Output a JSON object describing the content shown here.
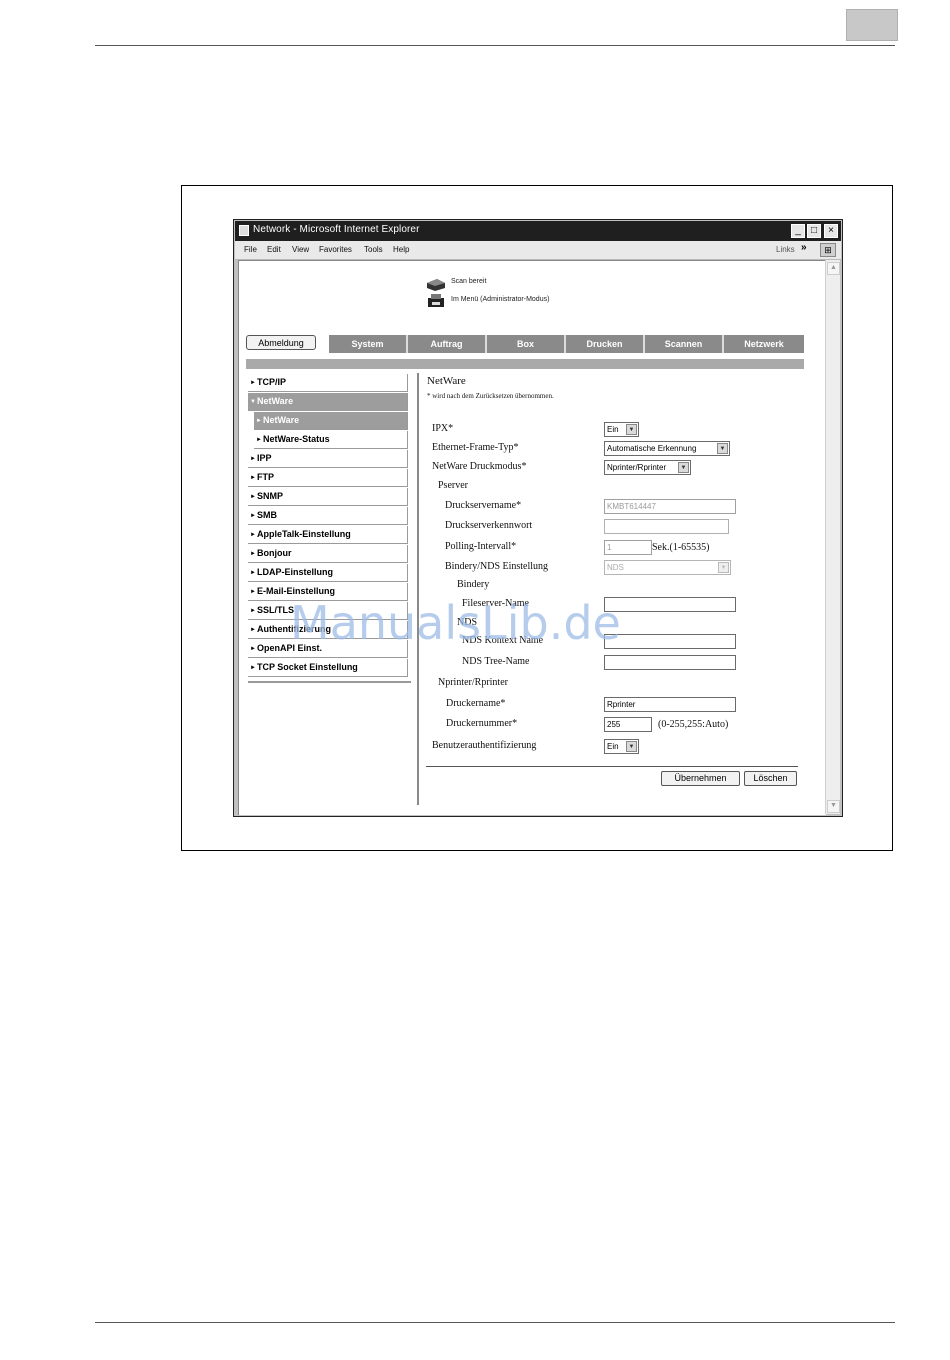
{
  "window": {
    "title": "Network - Microsoft Internet Explorer",
    "controls": [
      "_",
      "□",
      "×"
    ]
  },
  "menubar": {
    "items": [
      "File",
      "Edit",
      "View",
      "Favorites",
      "Tools",
      "Help"
    ],
    "links_label": "Links",
    "links_chevron": "»"
  },
  "status": {
    "line1": "Scan bereit",
    "line2": "Im Menü (Administrator-Modus)"
  },
  "nav": {
    "logout": "Abmeldung",
    "tabs": [
      "System",
      "Auftrag",
      "Box",
      "Drucken",
      "Scannen",
      "Netzwerk"
    ]
  },
  "sidebar": {
    "items": [
      {
        "label": "TCP/IP",
        "arrow": "►"
      },
      {
        "label": "NetWare",
        "arrow": "▼"
      },
      {
        "label": "NetWare",
        "arrow": "►"
      },
      {
        "label": "NetWare-Status",
        "arrow": "►"
      },
      {
        "label": "IPP",
        "arrow": "►"
      },
      {
        "label": "FTP",
        "arrow": "►"
      },
      {
        "label": "SNMP",
        "arrow": "►"
      },
      {
        "label": "SMB",
        "arrow": "►"
      },
      {
        "label": "AppleTalk-Einstellung",
        "arrow": "►"
      },
      {
        "label": "Bonjour",
        "arrow": "►"
      },
      {
        "label": "LDAP-Einstellung",
        "arrow": "►"
      },
      {
        "label": "E-Mail-Einstellung",
        "arrow": "►"
      },
      {
        "label": "SSL/TLS",
        "arrow": "►"
      },
      {
        "label": "Authentifizierung",
        "arrow": "►"
      },
      {
        "label": "OpenAPI Einst.",
        "arrow": "►"
      },
      {
        "label": "TCP Socket Einstellung",
        "arrow": "►"
      }
    ]
  },
  "form": {
    "heading": "NetWare",
    "note": "* wird nach dem Zurücksetzen übernommen.",
    "ipx": {
      "label": "IPX*",
      "value": "Ein"
    },
    "frame_type": {
      "label": "Ethernet-Frame-Typ*",
      "value": "Automatische Erkennung"
    },
    "print_mode": {
      "label": "NetWare Druckmodus*",
      "value": "Nprinter/Rprinter"
    },
    "pserver_section": "Pserver",
    "print_server_name": {
      "label": "Druckservername*",
      "value": "KMBT614447"
    },
    "print_server_password": {
      "label": "Druckserverkennwort",
      "value": ""
    },
    "polling": {
      "label": "Polling-Intervall*",
      "value": "1",
      "unit": "Sek.(1-65535)"
    },
    "bindery_nds": {
      "label": "Bindery/NDS Einstellung",
      "value": "NDS"
    },
    "bindery_section": "Bindery",
    "fileserver_name": {
      "label": "Fileserver-Name",
      "value": ""
    },
    "nds_section": "NDS",
    "nds_context": {
      "label": "NDS Kontext Name",
      "value": ""
    },
    "nds_tree": {
      "label": "NDS Tree-Name",
      "value": ""
    },
    "nprinter_section": "Nprinter/Rprinter",
    "printer_name": {
      "label": "Druckername*",
      "value": "Rprinter"
    },
    "printer_number": {
      "label": "Druckernummer*",
      "value": "255",
      "range": "(0-255,255:Auto)"
    },
    "user_auth": {
      "label": "Benutzerauthentifizierung",
      "value": "Ein"
    },
    "apply": "Übernehmen",
    "clear": "Löschen"
  },
  "watermark": "ManualsLib.de"
}
